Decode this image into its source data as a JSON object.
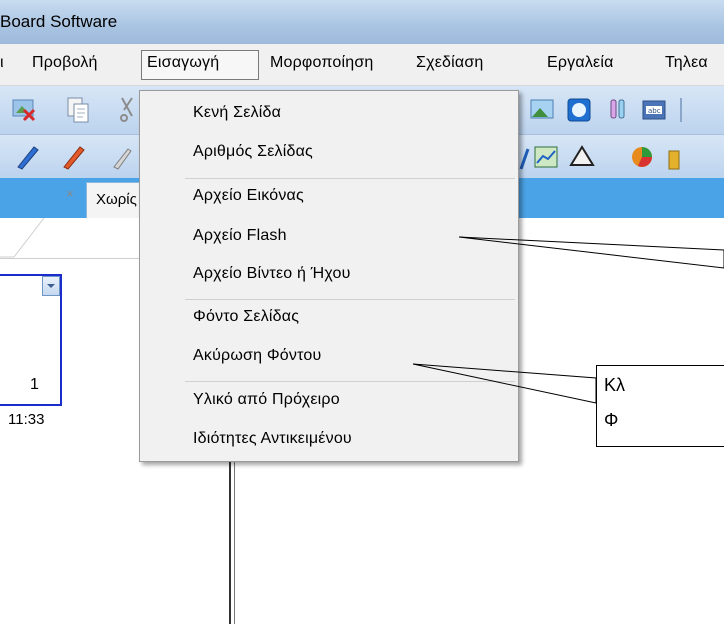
{
  "window": {
    "title": "Board Software"
  },
  "menubar": {
    "items": [
      {
        "label": "ι",
        "name": "menu-partial"
      },
      {
        "label": "Προβολή",
        "name": "menu-view"
      },
      {
        "label": "Εισαγωγή",
        "name": "menu-insert"
      },
      {
        "label": "Μορφοποίηση",
        "name": "menu-format"
      },
      {
        "label": "Σχεδίαση",
        "name": "menu-draw"
      },
      {
        "label": "Εργαλεία",
        "name": "menu-tools"
      },
      {
        "label": "Τηλεα",
        "name": "menu-tele"
      }
    ]
  },
  "toolbar1": {
    "icons": [
      "delete-image-icon",
      "copy-icon",
      "cut-icon",
      "image-icon",
      "globe-icon",
      "test-tubes-icon",
      "text-box-icon"
    ]
  },
  "toolbar2": {
    "icons": [
      "pencil-blue-icon",
      "pencil-red-icon",
      "pencil-icon",
      "pen-icon",
      "chart-icon",
      "triangle-icon",
      "pie-chart-icon",
      "bar-chart-icon"
    ]
  },
  "tabs": [
    {
      "label": "Χωρίς",
      "close": "×"
    }
  ],
  "pages": [
    {
      "number": "1",
      "time": "11:33"
    }
  ],
  "dropdown": {
    "groups": [
      [
        "Κενή Σελίδα",
        "Αριθμός Σελίδας"
      ],
      [
        "Αρχείο Εικόνας",
        "Αρχείο Flash",
        "Αρχείο Βίντεο ή Ήχου"
      ],
      [
        "Φόντο Σελίδας",
        "Ακύρωση Φόντου"
      ],
      [
        "Υλικό από Πρόχειρο",
        "Ιδιότητες Αντικειμένου"
      ]
    ]
  },
  "callout": {
    "line1": "Κλ",
    "line2": "Φ"
  },
  "colors": {
    "title_bar": "#a9c4e2",
    "tab_row": "#4aa3e6",
    "thumb_border": "#1a2dcc"
  }
}
